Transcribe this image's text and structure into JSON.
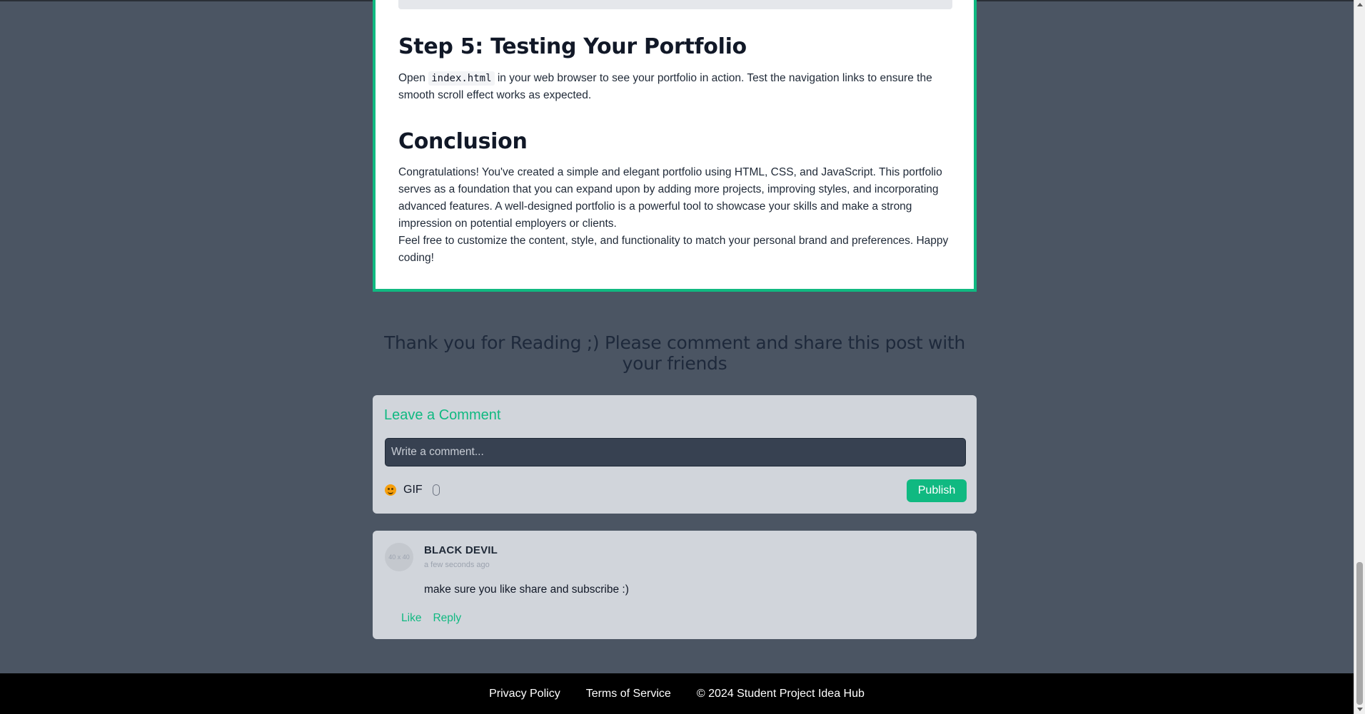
{
  "article": {
    "step5_title": "Step 5: Testing Your Portfolio",
    "step5_text_before": "Open ",
    "step5_code": "index.html",
    "step5_text_after": " in your web browser to see your portfolio in action. Test the navigation links to ensure the smooth scroll effect works as expected.",
    "conclusion_title": "Conclusion",
    "conclusion_p1": "Congratulations! You've created a simple and elegant portfolio using HTML, CSS, and JavaScript. This portfolio serves as a foundation that you can expand upon by adding more projects, improving styles, and incorporating advanced features. A well-designed portfolio is a powerful tool to showcase your skills and make a strong impression on potential employers or clients.",
    "conclusion_p2": "Feel free to customize the content, style, and functionality to match your personal brand and preferences. Happy coding!"
  },
  "thanks_text": "Thank you for Reading ;) Please comment and share this post with your friends",
  "comment_form": {
    "title": "Leave a Comment",
    "placeholder": "Write a comment...",
    "gif_label": "GIF",
    "publish_label": "Publish",
    "icons": [
      "emoji-icon",
      "paperclip-icon"
    ]
  },
  "comments": [
    {
      "avatar_text": "40 x 40",
      "author": "BLACK DEVIL",
      "time": "a few seconds ago",
      "text": "make sure you like share and subscribe :)",
      "like_label": "Like",
      "reply_label": "Reply"
    }
  ],
  "footer": {
    "privacy": "Privacy Policy",
    "terms": "Terms of Service",
    "copyright": "© 2024 Student Project Idea Hub"
  },
  "colors": {
    "page_bg": "#4b5563",
    "accent": "#10b981",
    "card_bg": "#d1d5db",
    "footer_bg": "#000000"
  }
}
